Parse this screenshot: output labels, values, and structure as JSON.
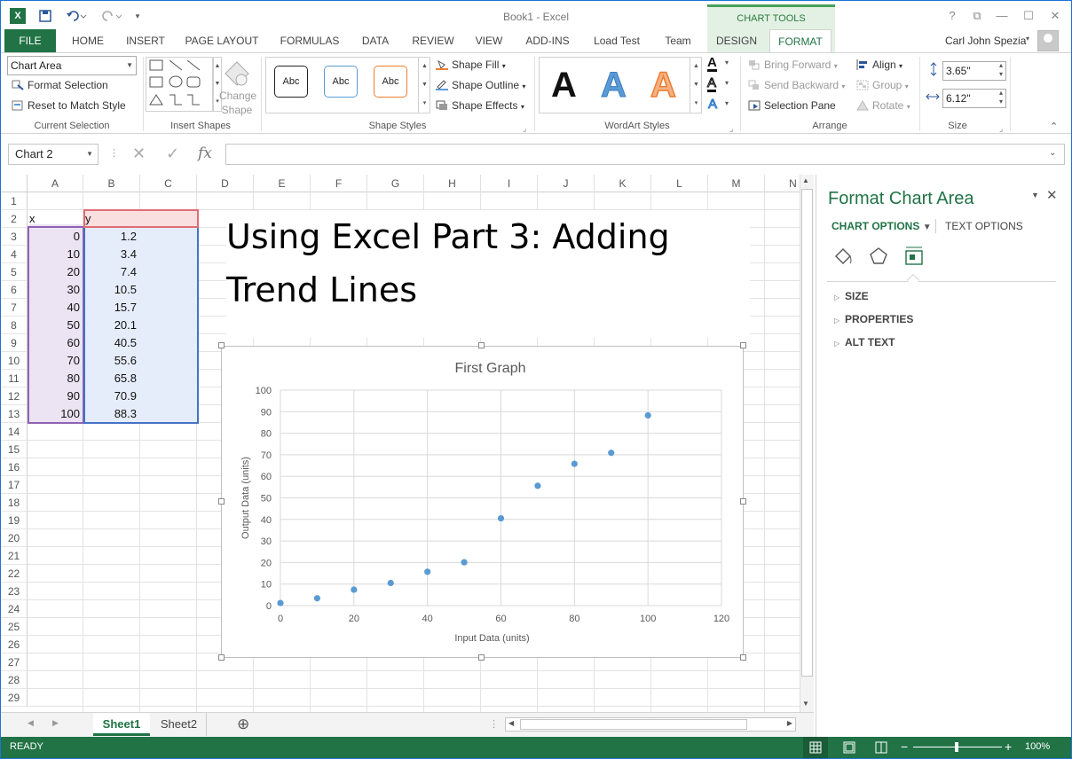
{
  "window": {
    "title": "Book1 - Excel"
  },
  "qat": {
    "save": "save-icon",
    "undo": "undo-icon",
    "redo": "redo-icon"
  },
  "title_controls": {
    "help": "?",
    "restore_ribbon": "⧉",
    "minimize": "—",
    "maximize": "☐",
    "close": "✕"
  },
  "contextual": {
    "label": "CHART TOOLS"
  },
  "tabs": [
    "FILE",
    "HOME",
    "INSERT",
    "PAGE LAYOUT",
    "FORMULAS",
    "DATA",
    "REVIEW",
    "VIEW",
    "ADD-INS",
    "Load Test",
    "Team",
    "DESIGN",
    "FORMAT"
  ],
  "user": {
    "name": "Carl John Spezia"
  },
  "ribbon": {
    "current_selection": {
      "combo": "Chart Area",
      "format_selection": "Format Selection",
      "reset": "Reset to Match Style",
      "label": "Current Selection"
    },
    "insert_shapes": {
      "change_shape_1": "Change",
      "change_shape_2": "Shape",
      "label": "Insert Shapes"
    },
    "shape_styles": {
      "sample": "Abc",
      "fill": "Shape Fill",
      "outline": "Shape Outline",
      "effects": "Shape Effects",
      "label": "Shape Styles"
    },
    "wordart": {
      "letter": "A",
      "label": "WordArt Styles"
    },
    "arrange": {
      "bring_forward": "Bring Forward",
      "send_backward": "Send Backward",
      "selection_pane": "Selection Pane",
      "align": "Align",
      "group": "Group",
      "rotate": "Rotate",
      "label": "Arrange"
    },
    "size": {
      "height": "3.65\"",
      "width": "6.12\"",
      "label": "Size"
    }
  },
  "formula_bar": {
    "name_box": "Chart 2",
    "fx": "fx",
    "cancel": "✕",
    "enter": "✓"
  },
  "columns": [
    "A",
    "B",
    "C",
    "D",
    "E",
    "F",
    "G",
    "H",
    "I",
    "J",
    "K",
    "L",
    "M",
    "N"
  ],
  "rows": [
    "1",
    "2",
    "3",
    "4",
    "5",
    "6",
    "7",
    "8",
    "9",
    "10",
    "11",
    "12",
    "13",
    "14",
    "15",
    "16",
    "17",
    "18",
    "19",
    "20",
    "21",
    "22",
    "23",
    "24",
    "25",
    "26",
    "27",
    "28",
    "29"
  ],
  "table": {
    "header_x": "x",
    "header_y": "y",
    "x": [
      "0",
      "10",
      "20",
      "30",
      "40",
      "50",
      "60",
      "70",
      "80",
      "90",
      "100"
    ],
    "y": [
      "1.2",
      "3.4",
      "7.4",
      "10.5",
      "15.7",
      "20.1",
      "40.5",
      "55.6",
      "65.8",
      "70.9",
      "88.3"
    ]
  },
  "heading": {
    "line1": "Using Excel Part 3:  Adding",
    "line2": "Trend Lines"
  },
  "chart_data": {
    "type": "scatter",
    "title": "First Graph",
    "xlabel": "Input Data (units)",
    "ylabel": "Output Data (units)",
    "xlim": [
      0,
      120
    ],
    "ylim": [
      0,
      100
    ],
    "xticks": [
      0,
      20,
      40,
      60,
      80,
      100,
      120
    ],
    "yticks": [
      0,
      10,
      20,
      30,
      40,
      50,
      60,
      70,
      80,
      90,
      100
    ],
    "grid": true,
    "series": [
      {
        "x": [
          0,
          10,
          20,
          30,
          40,
          50,
          60,
          70,
          80,
          90,
          100
        ],
        "y": [
          1.2,
          3.4,
          7.4,
          10.5,
          15.7,
          20.1,
          40.5,
          55.6,
          65.8,
          70.9,
          88.3
        ],
        "color": "#5b9bd5"
      }
    ]
  },
  "sheet_tabs": [
    "Sheet1",
    "Sheet2"
  ],
  "add_sheet": "⊕",
  "status": {
    "mode": "READY",
    "zoom": "100%"
  },
  "pane": {
    "title": "Format Chart Area",
    "chart_options": "CHART OPTIONS",
    "text_options": "TEXT OPTIONS",
    "sections": [
      "SIZE",
      "PROPERTIES",
      "ALT TEXT"
    ]
  },
  "colors": {
    "excel_green": "#217346",
    "tools_bg": "#e3f1e5",
    "accent_blue": "#5b9bd5"
  }
}
